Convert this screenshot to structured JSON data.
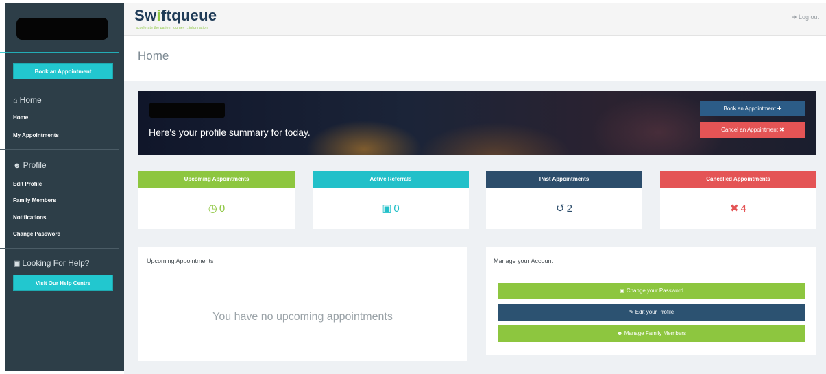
{
  "brand": {
    "name_part1": "Sw",
    "name_accent": "i",
    "name_part2": "ftqueue",
    "tagline": "accelerate the patient journey ...information",
    "logout": "Log out",
    "logout_icon": "sign-out-icon"
  },
  "sidebar": {
    "book_button": "Book an Appointment",
    "home_section": {
      "icon": "home-icon",
      "label": "Home",
      "links": [
        "Home",
        "My Appointments"
      ]
    },
    "profile_section": {
      "icon": "user-icon",
      "label": "Profile",
      "links": [
        "Edit Profile",
        "Family Members",
        "Notifications",
        "Change Password"
      ]
    },
    "help_section": {
      "icon": "question-icon",
      "label": "Looking For Help?",
      "button": "Visit Our Help Centre"
    }
  },
  "page": {
    "title": "Home"
  },
  "banner": {
    "text": "Here's your profile summary for today.",
    "book_button": "Book an Appointment",
    "cancel_button": "Cancel an Appointment"
  },
  "stats": [
    {
      "label": "Upcoming Appointments",
      "value": "0",
      "icon": "clock-icon",
      "color": "#8dc63f"
    },
    {
      "label": "Active Referrals",
      "value": "0",
      "icon": "calendar-icon",
      "color": "#22c0c9"
    },
    {
      "label": "Past Appointments",
      "value": "2",
      "icon": "history-icon",
      "color": "#2c4d6b"
    },
    {
      "label": "Cancelled Appointments",
      "value": "4",
      "icon": "times-circle-icon",
      "color": "#e45455"
    }
  ],
  "upcoming_panel": {
    "title": "Upcoming Appointments",
    "empty_message": "You have no upcoming appointments"
  },
  "account_panel": {
    "title": "Manage your Account",
    "buttons": [
      "Change your Password",
      "Edit your Profile",
      "Manage Family Members"
    ],
    "button_icons": [
      "lock-icon",
      "edit-icon",
      "users-icon"
    ]
  },
  "colors": {
    "sidebar_bg": "#2d3e48",
    "accent_cyan": "#22c7cf",
    "green": "#8dc63f",
    "navy": "#2c5271",
    "red": "#e45455"
  }
}
